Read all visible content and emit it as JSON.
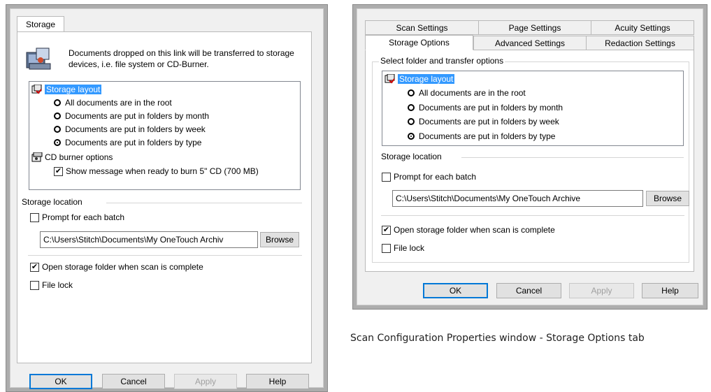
{
  "left_dialog": {
    "tab_label": "Storage",
    "description": "Documents dropped on this link will be transferred to storage devices, i.e. file system or CD-Burner.",
    "tree": {
      "storage_layout": "Storage layout",
      "options": [
        {
          "label": "All documents are in the root",
          "selected": false
        },
        {
          "label": "Documents are put in folders by month",
          "selected": false
        },
        {
          "label": "Documents are put in folders by week",
          "selected": false
        },
        {
          "label": "Documents are put in folders by type",
          "selected": true
        }
      ],
      "cd_burner": "CD burner options",
      "cd_message": "Show message when ready to burn 5\" CD (700 MB)",
      "cd_message_checked": true
    },
    "storage_location": "Storage location",
    "prompt_each_batch": "Prompt for each batch",
    "path": "C:\\Users\\Stitch\\Documents\\My OneTouch Archiv",
    "browse": "Browse",
    "open_folder": "Open storage folder when scan is complete",
    "file_lock": "File lock",
    "buttons": {
      "ok": "OK",
      "cancel": "Cancel",
      "apply": "Apply",
      "help": "Help"
    }
  },
  "right_dialog": {
    "tabs_row1": [
      "Scan Settings",
      "Page Settings",
      "Acuity Settings"
    ],
    "tabs_row2": [
      "Storage Options",
      "Advanced Settings",
      "Redaction Settings"
    ],
    "active_tab": "Storage Options",
    "group_title": "Select folder and transfer options",
    "tree": {
      "storage_layout": "Storage layout",
      "options": [
        {
          "label": "All documents are in the root",
          "selected": false
        },
        {
          "label": "Documents are put in folders by month",
          "selected": false
        },
        {
          "label": "Documents are put in folders by week",
          "selected": false
        },
        {
          "label": "Documents are put in folders by type",
          "selected": true
        }
      ]
    },
    "storage_location": "Storage location",
    "prompt_each_batch": "Prompt for each batch",
    "path": "C:\\Users\\Stitch\\Documents\\My OneTouch Archive",
    "browse": "Browse",
    "open_folder": "Open storage folder when scan is complete",
    "file_lock": "File lock",
    "buttons": {
      "ok": "OK",
      "cancel": "Cancel",
      "apply": "Apply",
      "help": "Help"
    }
  },
  "caption": "Scan Configuration Properties window - Storage Options tab",
  "colors": {
    "highlight": "#3399ff",
    "dialog_bg": "#f0f0f0",
    "frame": "#adadad",
    "default_button_border": "#0078d7"
  }
}
